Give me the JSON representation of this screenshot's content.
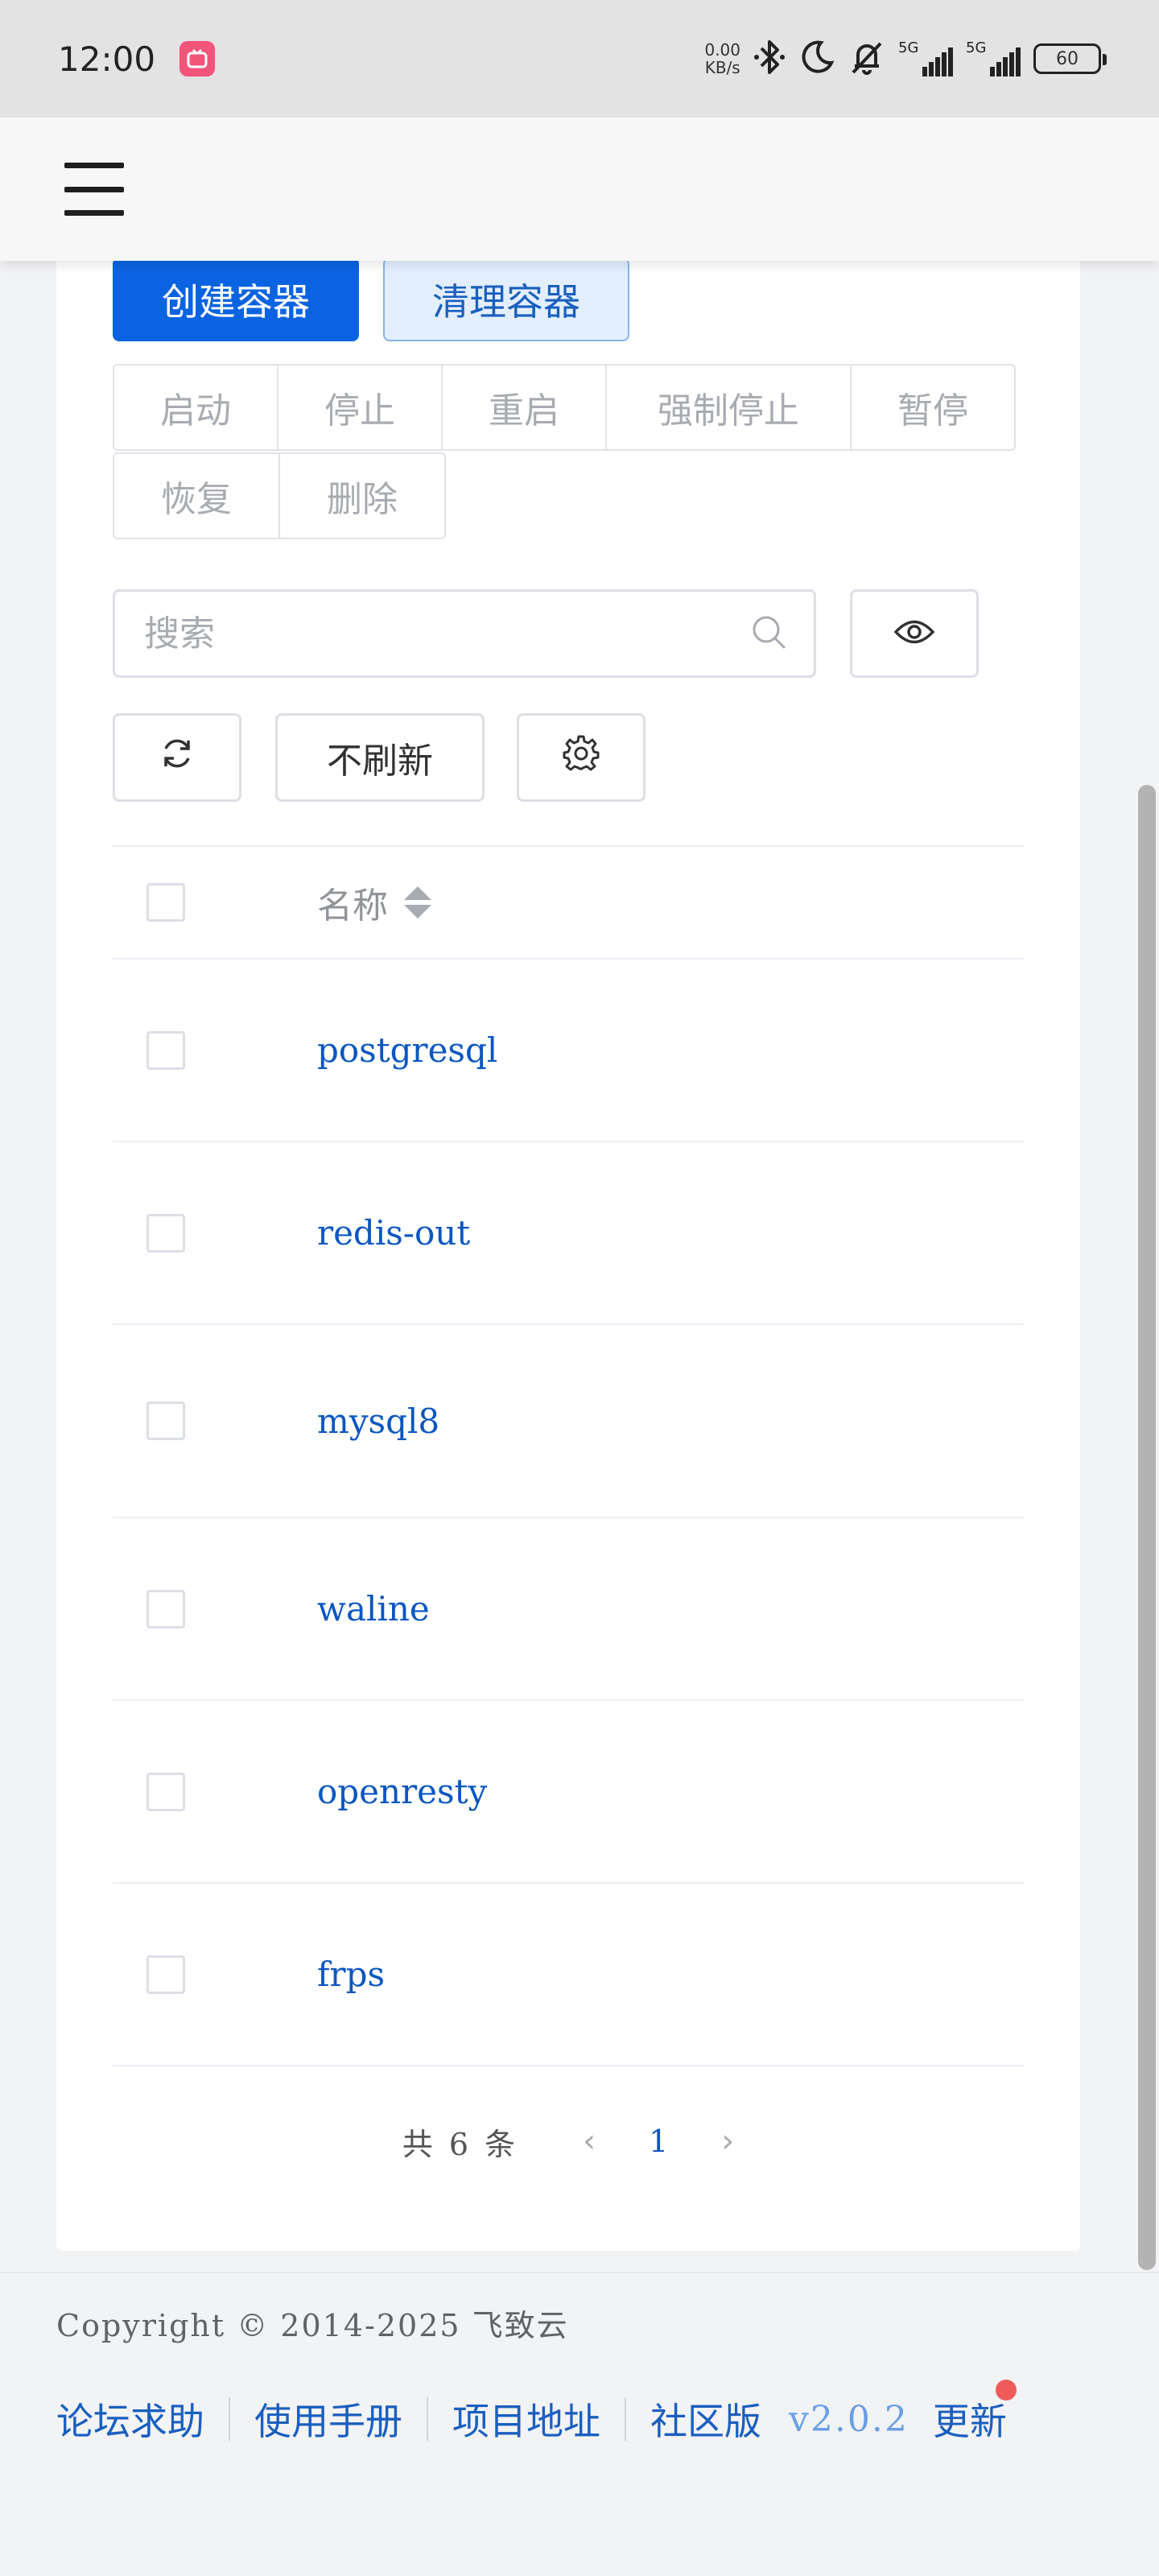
{
  "status_bar": {
    "time": "12:00",
    "speed_value": "0.00",
    "speed_unit": "KB/s",
    "signal1_label": "5G",
    "signal2_label": "5G",
    "battery": "60",
    "icons": [
      "app-notification-icon",
      "bluetooth-icon",
      "moon-icon",
      "bell-off-icon"
    ]
  },
  "header": {
    "menu_icon": "hamburger-icon"
  },
  "toolbar": {
    "create_label": "创建容器",
    "clean_label": "清理容器",
    "actions": [
      "启动",
      "停止",
      "重启",
      "强制停止",
      "暂停",
      "恢复",
      "删除"
    ]
  },
  "search": {
    "placeholder": "搜索",
    "value": ""
  },
  "controls": {
    "refresh_mode_label": "不刷新"
  },
  "table": {
    "header_name": "名称",
    "rows": [
      "postgresql",
      "redis-out",
      "mysql8",
      "waline",
      "openresty",
      "frps"
    ]
  },
  "pagination": {
    "total_text": "共 6 条",
    "current_page": "1"
  },
  "footer": {
    "copyright": "Copyright © 2014-2025 飞致云",
    "links": [
      "论坛求助",
      "使用手册",
      "项目地址",
      "社区版"
    ],
    "version": "v2.0.2",
    "update_label": "更新"
  },
  "colors": {
    "primary": "#0a63e0",
    "link": "#0a56c2",
    "badge": "#ee5a5a"
  }
}
